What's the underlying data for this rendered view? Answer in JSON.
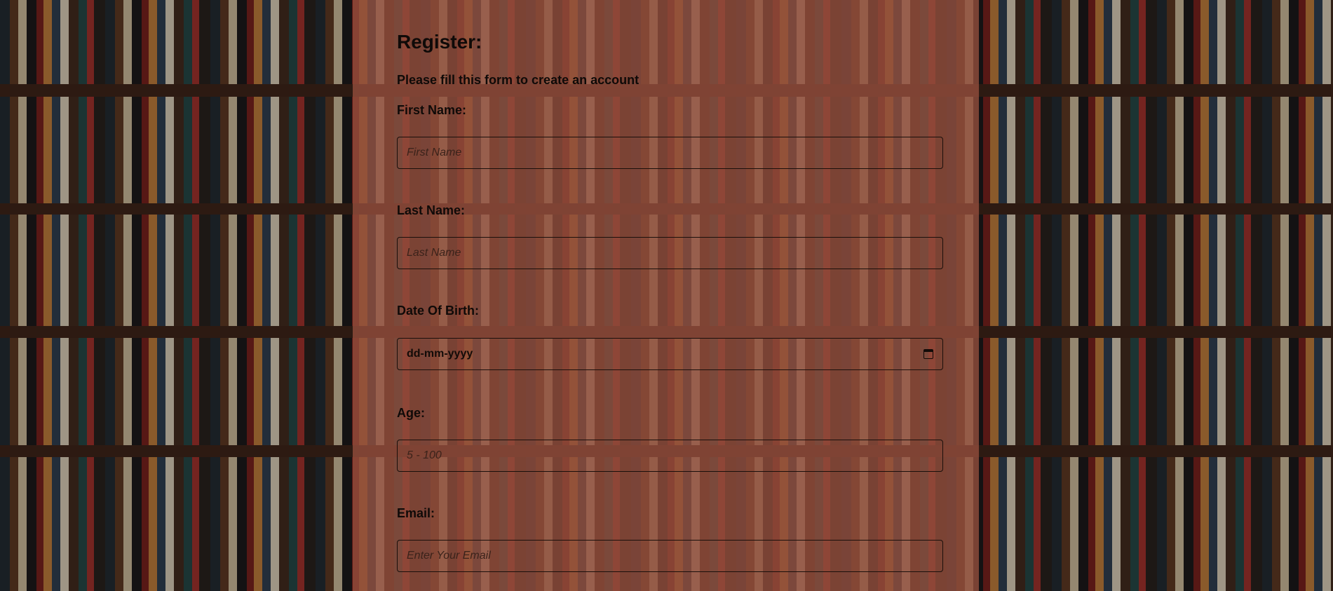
{
  "form": {
    "title": "Register:",
    "subtitle": "Please fill this form to create an account",
    "fields": [
      {
        "label": "First Name:",
        "placeholder": "First Name"
      },
      {
        "label": "Last Name:",
        "placeholder": "Last Name"
      },
      {
        "label": "Date Of Birth:",
        "placeholder": "dd-mm-yyyy",
        "icon": "calendar-icon"
      },
      {
        "label": "Age:",
        "placeholder": "5 - 100"
      },
      {
        "label": "Email:",
        "placeholder": "Enter Your Email"
      }
    ]
  },
  "colors": {
    "panel": "#96503E",
    "text": "#0F0A08",
    "border": "#1A0F0B"
  }
}
